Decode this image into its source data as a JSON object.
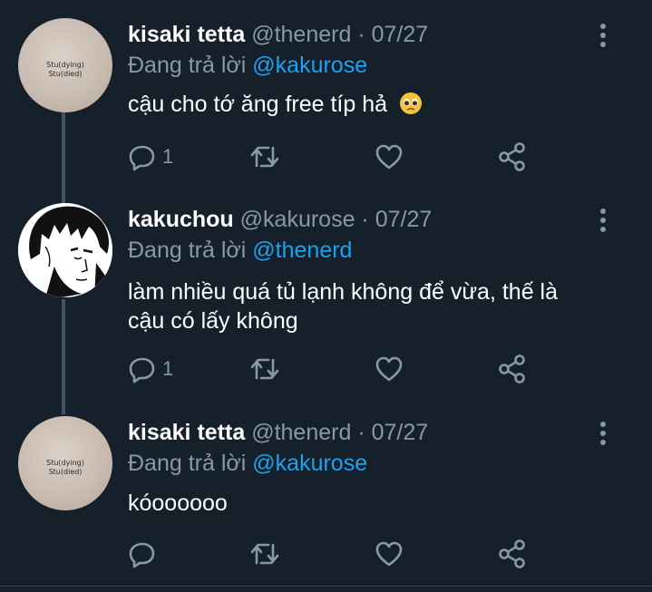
{
  "tweets": [
    {
      "name": "kisaki tetta",
      "meta": "@thenerd · 07/27",
      "reply_prefix": "Đang trả lời ",
      "reply_to": "@kakurose",
      "text": "cậu cho tớ ăng free típ hả",
      "emoji": "pleading-face",
      "reply_count": "1",
      "avatar": "shirt",
      "shirt_text": [
        "Stu(dying)",
        "Stu(died)"
      ]
    },
    {
      "name": "kakuchou",
      "meta": "@kakurose · 07/27",
      "reply_prefix": "Đang trả lời ",
      "reply_to": "@thenerd",
      "text_lines": [
        "làm nhiều quá tủ lạnh không để vừa, thế là",
        "cậu có lấy không"
      ],
      "reply_count": "1",
      "avatar": "manga"
    },
    {
      "name": "kisaki tetta",
      "meta": "@thenerd · 07/27",
      "reply_prefix": "Đang trả lời ",
      "reply_to": "@kakurose",
      "text": "kóoooooo",
      "reply_count": "",
      "avatar": "shirt",
      "shirt_text": [
        "Stu(dying)",
        "Stu(died)"
      ]
    }
  ],
  "icons": [
    "reply-icon",
    "retweet-icon",
    "like-icon",
    "share-icon",
    "more-options-icon"
  ],
  "colors": {
    "background": "#15202b",
    "mention": "#1da1f2",
    "muted": "#8899a6",
    "thread_line": "#3d5466"
  }
}
